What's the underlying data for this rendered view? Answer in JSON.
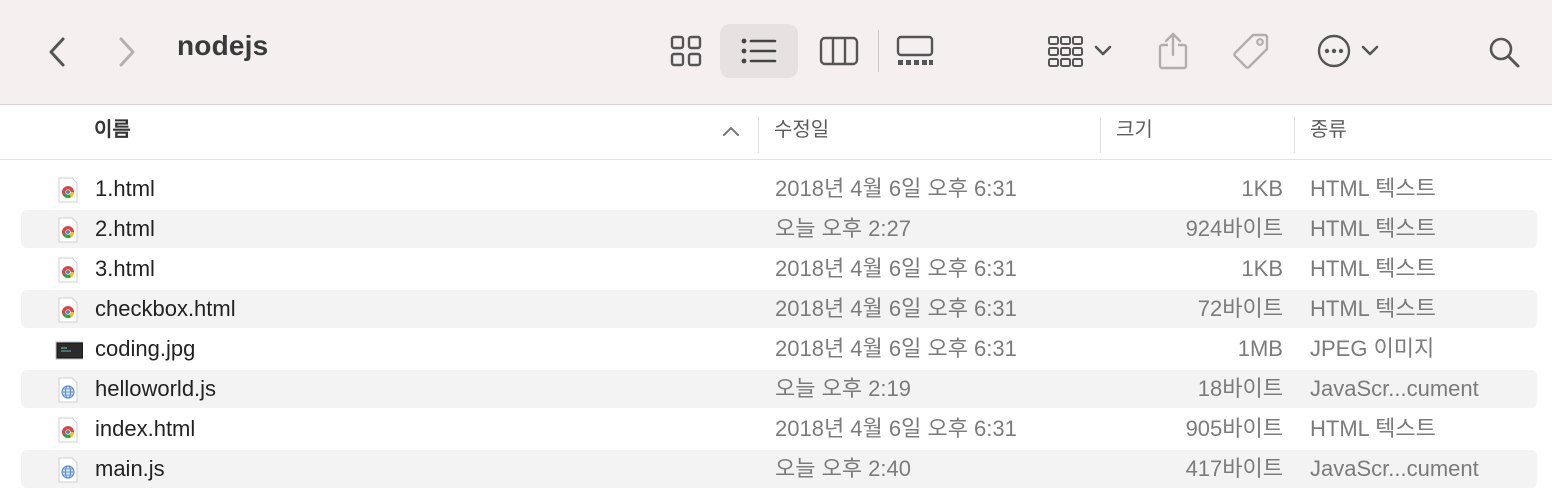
{
  "window": {
    "title": "nodejs"
  },
  "columns": {
    "name": "이름",
    "date": "수정일",
    "size": "크기",
    "kind": "종류"
  },
  "files": [
    {
      "name": "1.html",
      "date": "2018년 4월 6일 오후 6:31",
      "size": "1KB",
      "kind": "HTML 텍스트",
      "icon": "chrome-html-file-icon"
    },
    {
      "name": "2.html",
      "date": "오늘 오후 2:27",
      "size": "924바이트",
      "kind": "HTML 텍스트",
      "icon": "chrome-html-file-icon"
    },
    {
      "name": "3.html",
      "date": "2018년 4월 6일 오후 6:31",
      "size": "1KB",
      "kind": "HTML 텍스트",
      "icon": "chrome-html-file-icon"
    },
    {
      "name": "checkbox.html",
      "date": "2018년 4월 6일 오후 6:31",
      "size": "72바이트",
      "kind": "HTML 텍스트",
      "icon": "chrome-html-file-icon"
    },
    {
      "name": "coding.jpg",
      "date": "2018년 4월 6일 오후 6:31",
      "size": "1MB",
      "kind": "JPEG 이미지",
      "icon": "image-thumbnail-icon"
    },
    {
      "name": "helloworld.js",
      "date": "오늘 오후 2:19",
      "size": "18바이트",
      "kind": "JavaScr...cument",
      "icon": "js-file-icon"
    },
    {
      "name": "index.html",
      "date": "2018년 4월 6일 오후 6:31",
      "size": "905바이트",
      "kind": "HTML 텍스트",
      "icon": "chrome-html-file-icon"
    },
    {
      "name": "main.js",
      "date": "오늘 오후 2:40",
      "size": "417바이트",
      "kind": "JavaScr...cument",
      "icon": "js-file-icon"
    }
  ],
  "colors": {
    "toolbar_bg": "#f6efef",
    "alt_row": "#f3f3f3",
    "secondary_text": "#7b7b7b"
  }
}
